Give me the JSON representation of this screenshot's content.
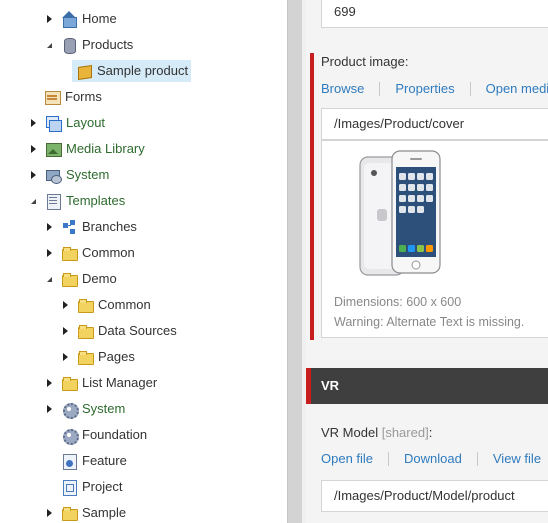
{
  "tree": {
    "items": [
      {
        "label": "Home"
      },
      {
        "label": "Products"
      },
      {
        "label": "Sample product"
      },
      {
        "label": "Forms"
      },
      {
        "label": "Layout"
      },
      {
        "label": "Media Library"
      },
      {
        "label": "System"
      },
      {
        "label": "Templates"
      },
      {
        "label": "Branches"
      },
      {
        "label": "Common"
      },
      {
        "label": "Demo"
      },
      {
        "label": "Common"
      },
      {
        "label": "Data Sources"
      },
      {
        "label": "Pages"
      },
      {
        "label": "List Manager"
      },
      {
        "label": "System"
      },
      {
        "label": "Foundation"
      },
      {
        "label": "Feature"
      },
      {
        "label": "Project"
      },
      {
        "label": "Sample"
      }
    ]
  },
  "editor": {
    "price_value": "699",
    "product_image": {
      "label": "Product image:",
      "actions": [
        "Browse",
        "Properties",
        "Open media"
      ],
      "path": "/Images/Product/cover",
      "dimensions": "Dimensions: 600 x 600",
      "warning": "Warning: Alternate Text is missing."
    },
    "vr_section": {
      "title": "VR",
      "field_label": "VR Model",
      "shared_tag": "[shared]",
      "colon": ":",
      "actions": [
        "Open file",
        "Download",
        "View file"
      ],
      "path": "/Images/Product/Model/product"
    }
  },
  "colors": {
    "link": "#2e7bbf",
    "accent_red": "#c81e1e",
    "section_header_bg": "#3f3f3f",
    "selected_bg": "#d6ebf8",
    "green_label": "#2e6b2e"
  }
}
